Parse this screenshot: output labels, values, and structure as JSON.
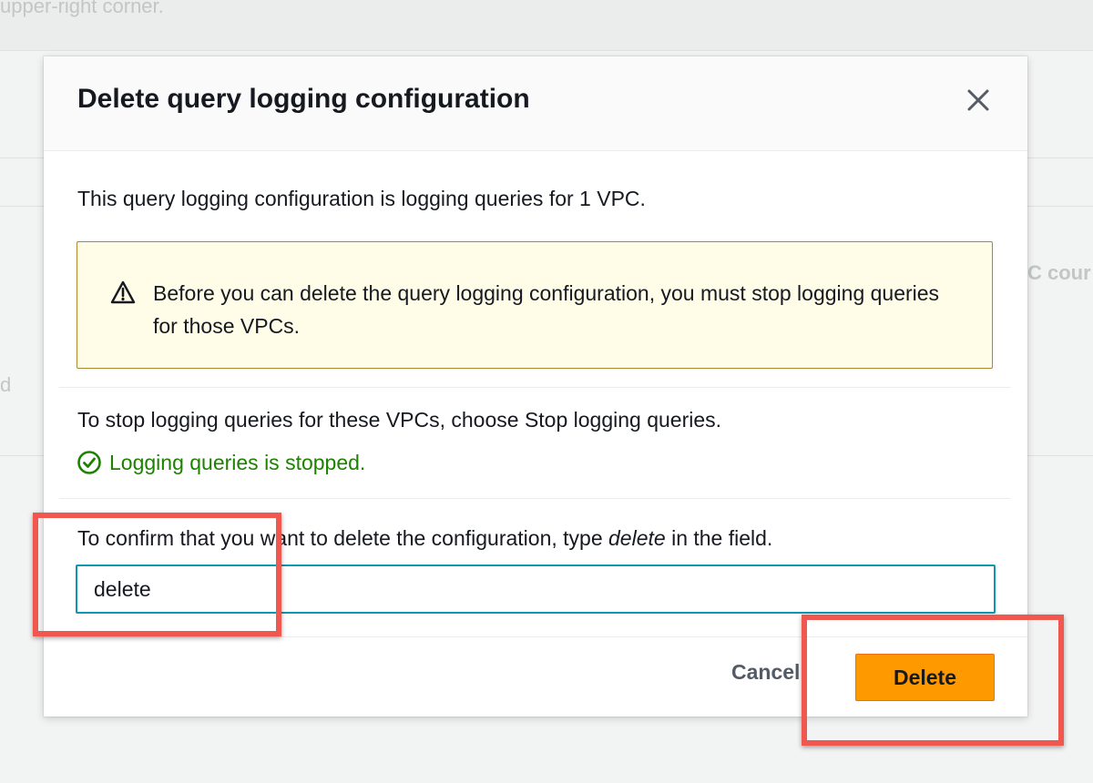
{
  "background": {
    "top_text": "upper-right corner.",
    "right_text": "C cour",
    "left_text": "d"
  },
  "modal": {
    "title": "Delete query logging configuration",
    "close_icon": "close-icon",
    "vpc_info": "This query logging configuration is logging queries for 1 VPC.",
    "alert": {
      "type": "warning",
      "icon": "warning-triangle-icon",
      "text": "Before you can delete the query logging configuration, you must stop logging queries for those VPCs."
    },
    "stop_instruction": "To stop logging queries for these VPCs, choose Stop logging queries.",
    "status": {
      "icon": "check-circle-icon",
      "text": "Logging queries is stopped.",
      "color": "#1d8102"
    },
    "confirm": {
      "prefix": "To confirm that you want to delete the configuration, type ",
      "keyword": "delete",
      "suffix": " in the field.",
      "input_value": "delete"
    },
    "buttons": {
      "cancel": "Cancel",
      "delete": "Delete"
    }
  },
  "colors": {
    "primary_button": "#ff9900",
    "input_focus": "#0e97b3",
    "alert_background": "#fffce8",
    "alert_border": "#a9892b",
    "highlight": "#f0584f"
  }
}
